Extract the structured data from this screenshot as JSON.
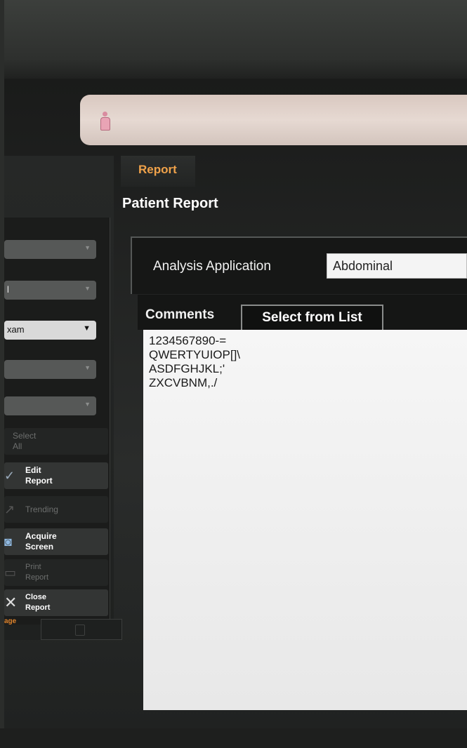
{
  "report": {
    "tab_label": "Report",
    "title": "Patient Report",
    "analysis_application_label": "Analysis Application",
    "analysis_application_value": "Abdominal",
    "comments_label": "Comments",
    "select_from_list_label": "Select from List",
    "comments_lines": [
      "1234567890-=",
      "QWERTYUIOP[]\\",
      "ASDFGHJKL;'",
      "ZXCVBNM,./"
    ]
  },
  "left_panel": {
    "dropdown_3_value": "xam",
    "dropdown_2_value": "l",
    "buttons": {
      "select_all": "Select\nAll",
      "edit_report": "Edit\nReport",
      "trending": "Trending",
      "acquire_screen": "Acquire\nScreen",
      "print_report": "Print\nReport",
      "close_report": "Close\nReport"
    },
    "image_link": "age"
  },
  "icons": {
    "patient": "patient-female-icon",
    "close": "close-icon",
    "edit": "edit-icon",
    "acquire": "camera-icon",
    "print": "printer-icon",
    "dropdown": "chevron-down-icon"
  },
  "colors": {
    "report_tab_accent": "#f0a24a",
    "patient_bar": "#e6d9d2"
  }
}
